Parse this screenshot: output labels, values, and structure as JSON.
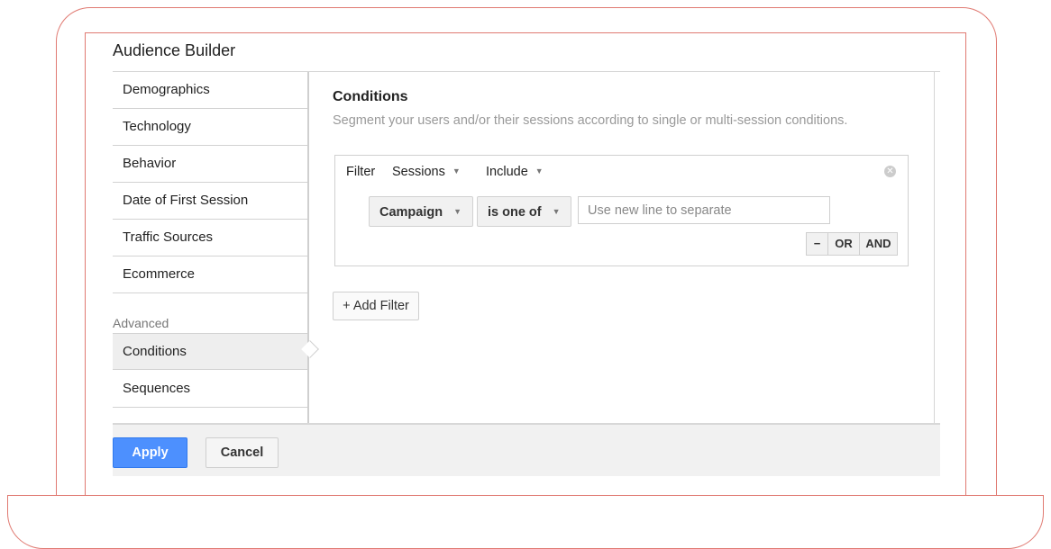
{
  "window": {
    "title": "Audience Builder"
  },
  "sidebar": {
    "items": [
      {
        "label": "Demographics"
      },
      {
        "label": "Technology"
      },
      {
        "label": "Behavior"
      },
      {
        "label": "Date of First Session"
      },
      {
        "label": "Traffic Sources"
      },
      {
        "label": "Ecommerce"
      }
    ],
    "advanced_label": "Advanced",
    "advanced_items": [
      {
        "label": "Conditions",
        "active": true
      },
      {
        "label": "Sequences",
        "active": false
      }
    ]
  },
  "main": {
    "title": "Conditions",
    "description": "Segment your users and/or their sessions according to single or multi-session conditions.",
    "filter": {
      "label": "Filter",
      "scope": "Sessions",
      "mode": "Include",
      "dimension": "Campaign",
      "operator": "is one of",
      "value_placeholder": "Use new line to separate",
      "minus_label": "−",
      "or_label": "OR",
      "and_label": "AND"
    },
    "add_filter_label": "+ Add Filter"
  },
  "footer": {
    "apply_label": "Apply",
    "cancel_label": "Cancel"
  },
  "colors": {
    "frame": "#e07a72",
    "primary_button": "#4d90fe"
  }
}
